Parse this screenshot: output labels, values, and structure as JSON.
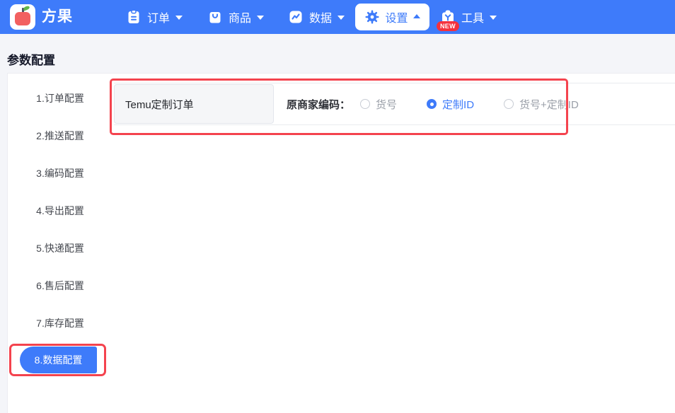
{
  "topbar": {
    "brand": "方果",
    "nav": [
      {
        "label": "订单",
        "icon": "clipboard-icon",
        "caret": "down"
      },
      {
        "label": "商品",
        "icon": "bag-icon",
        "caret": "down"
      },
      {
        "label": "数据",
        "icon": "chart-icon",
        "caret": "down"
      },
      {
        "label": "设置",
        "icon": "gear-icon",
        "caret": "up",
        "active": true
      },
      {
        "label": "工具",
        "icon": "toolbox-icon",
        "caret": "down",
        "badge": "NEW"
      }
    ]
  },
  "page": {
    "title": "参数配置"
  },
  "sidebar": {
    "items": [
      {
        "label": "1.订单配置",
        "active": false
      },
      {
        "label": "2.推送配置",
        "active": false
      },
      {
        "label": "3.编码配置",
        "active": false
      },
      {
        "label": "4.导出配置",
        "active": false
      },
      {
        "label": "5.快递配置",
        "active": false
      },
      {
        "label": "6.售后配置",
        "active": false
      },
      {
        "label": "7.库存配置",
        "active": false
      },
      {
        "label": "8.数据配置",
        "active": true
      }
    ]
  },
  "settings_row": {
    "name": "Temu定制订单",
    "field_label": "原商家编码：",
    "options": [
      {
        "label": "货号",
        "selected": false
      },
      {
        "label": "定制ID",
        "selected": true
      },
      {
        "label": "货号+定制ID",
        "selected": false
      }
    ]
  },
  "colors": {
    "primary_blue": "#3e7bfa",
    "annotation_red": "#f4434e",
    "badge_red": "#f5313d",
    "topbar_bg": "#3e7bfa",
    "page_bg": "#f4f5f9"
  }
}
